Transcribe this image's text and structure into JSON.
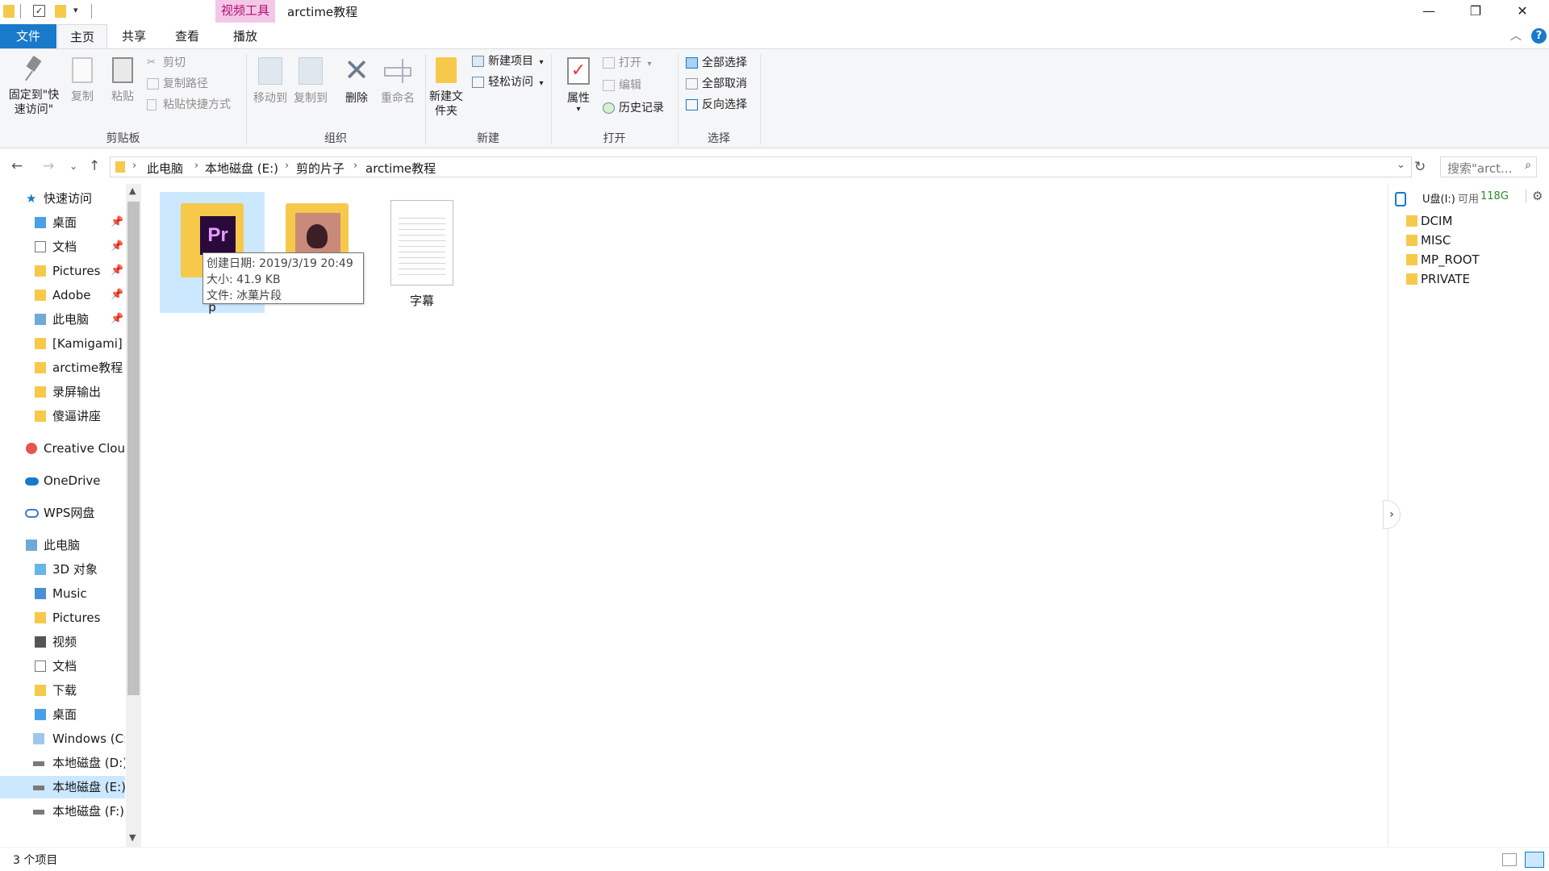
{
  "titlebar": {
    "tool_tab": "视频工具",
    "title": "arctime教程",
    "minimize": "—",
    "restore": "❐",
    "close": "✕"
  },
  "tabs": [
    {
      "label": "文件"
    },
    {
      "label": "主页"
    },
    {
      "label": "共享"
    },
    {
      "label": "查看"
    },
    {
      "label": "播放"
    }
  ],
  "ribbon": {
    "clipboard": {
      "pin_label": "固定到\"快速访问\"",
      "copy": "复制",
      "paste": "粘贴",
      "cut": "剪切",
      "copy_path": "复制路径",
      "paste_shortcut": "粘贴快捷方式",
      "group": "剪贴板"
    },
    "organize": {
      "move_to": "移动到",
      "copy_to": "复制到",
      "delete": "删除",
      "rename": "重命名",
      "group": "组织"
    },
    "new": {
      "new_folder": "新建文件夹",
      "new_item": "新建项目",
      "easy_access": "轻松访问",
      "group": "新建"
    },
    "open": {
      "properties": "属性",
      "open": "打开",
      "edit": "编辑",
      "history": "历史记录",
      "group": "打开"
    },
    "select": {
      "select_all": "全部选择",
      "select_none": "全部取消",
      "invert": "反向选择",
      "group": "选择"
    }
  },
  "address": {
    "crumbs": [
      "此电脑",
      "本地磁盘 (E:)",
      "剪的片子",
      "arctime教程"
    ],
    "search_placeholder": "搜索\"arct...",
    "search_icon": "search-icon"
  },
  "sidebar": {
    "items": [
      {
        "label": "快速访问",
        "icon": "star-icon"
      },
      {
        "label": "桌面",
        "icon": "desktop-folder-icon"
      },
      {
        "label": "文档",
        "icon": "documents-folder-icon"
      },
      {
        "label": "Pictures",
        "icon": "pictures-folder-icon"
      },
      {
        "label": "Adobe",
        "icon": "folder-icon"
      },
      {
        "label": "此电脑",
        "icon": "computer-icon"
      },
      {
        "label": "[Kamigami] H",
        "icon": "folder-icon"
      },
      {
        "label": "arctime教程",
        "icon": "folder-icon"
      },
      {
        "label": "录屏输出",
        "icon": "folder-icon"
      },
      {
        "label": "傻逼讲座",
        "icon": "folder-icon"
      },
      {
        "label": "Creative Cloud",
        "icon": "creative-cloud-icon"
      },
      {
        "label": "OneDrive",
        "icon": "onedrive-icon"
      },
      {
        "label": "WPS网盘",
        "icon": "wps-cloud-icon"
      },
      {
        "label": "此电脑",
        "icon": "computer-icon"
      },
      {
        "label": "3D 对象",
        "icon": "3d-objects-icon"
      },
      {
        "label": "Music",
        "icon": "music-folder-icon"
      },
      {
        "label": "Pictures",
        "icon": "pictures-folder-icon"
      },
      {
        "label": "视频",
        "icon": "videos-folder-icon"
      },
      {
        "label": "文档",
        "icon": "documents-folder-icon"
      },
      {
        "label": "下载",
        "icon": "downloads-folder-icon"
      },
      {
        "label": "桌面",
        "icon": "desktop-folder-icon"
      },
      {
        "label": "Windows (C:",
        "icon": "drive-c-icon"
      },
      {
        "label": "本地磁盘 (D:)",
        "icon": "drive-icon"
      },
      {
        "label": "本地磁盘 (E:)",
        "icon": "drive-icon"
      },
      {
        "label": "本地磁盘 (F:)",
        "icon": "drive-icon"
      }
    ]
  },
  "files": [
    {
      "label": "p",
      "icon": "premiere-folder-icon"
    },
    {
      "label": "",
      "icon": "image-folder-icon"
    },
    {
      "label": "字幕",
      "icon": "text-file-icon"
    }
  ],
  "tooltip": {
    "line1": "创建日期: 2019/3/19 20:49",
    "line2": "大小: 41.9 KB",
    "line3": "文件: 冰菓片段"
  },
  "rightpane": {
    "drive": "U盘(I:)",
    "free_prefix": "可用",
    "free_value": "118G",
    "folders": [
      "DCIM",
      "MISC",
      "MP_ROOT",
      "PRIVATE"
    ]
  },
  "status": {
    "count": "3 个项目"
  },
  "colors": {
    "accent": "#1979ca",
    "tool_tab": "#f4c7e8",
    "selection": "#cce8ff",
    "folder": "#f6c94b"
  }
}
